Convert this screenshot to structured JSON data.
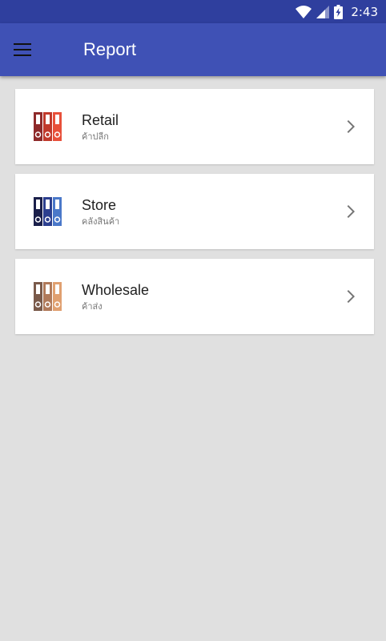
{
  "status_bar": {
    "time": "2:43",
    "icons": [
      "wifi-icon",
      "signal-icon",
      "battery-charging-icon"
    ]
  },
  "app_bar": {
    "title": "Report",
    "menu_icon": "menu-icon",
    "color": "#3f51b5"
  },
  "items": [
    {
      "title": "Retail",
      "subtitle": "ค้าปลีก",
      "icon": "binders-icon",
      "colors": [
        "#8e2a2a",
        "#c0392b",
        "#e8503a"
      ]
    },
    {
      "title": "Store",
      "subtitle": "คลังสินค้า",
      "icon": "binders-icon",
      "colors": [
        "#1a1f4a",
        "#2c3f8f",
        "#4a78c9"
      ]
    },
    {
      "title": "Wholesale",
      "subtitle": "ค้าส่ง",
      "icon": "binders-icon",
      "colors": [
        "#7a5a4a",
        "#b07a5a",
        "#e0a070"
      ]
    }
  ]
}
